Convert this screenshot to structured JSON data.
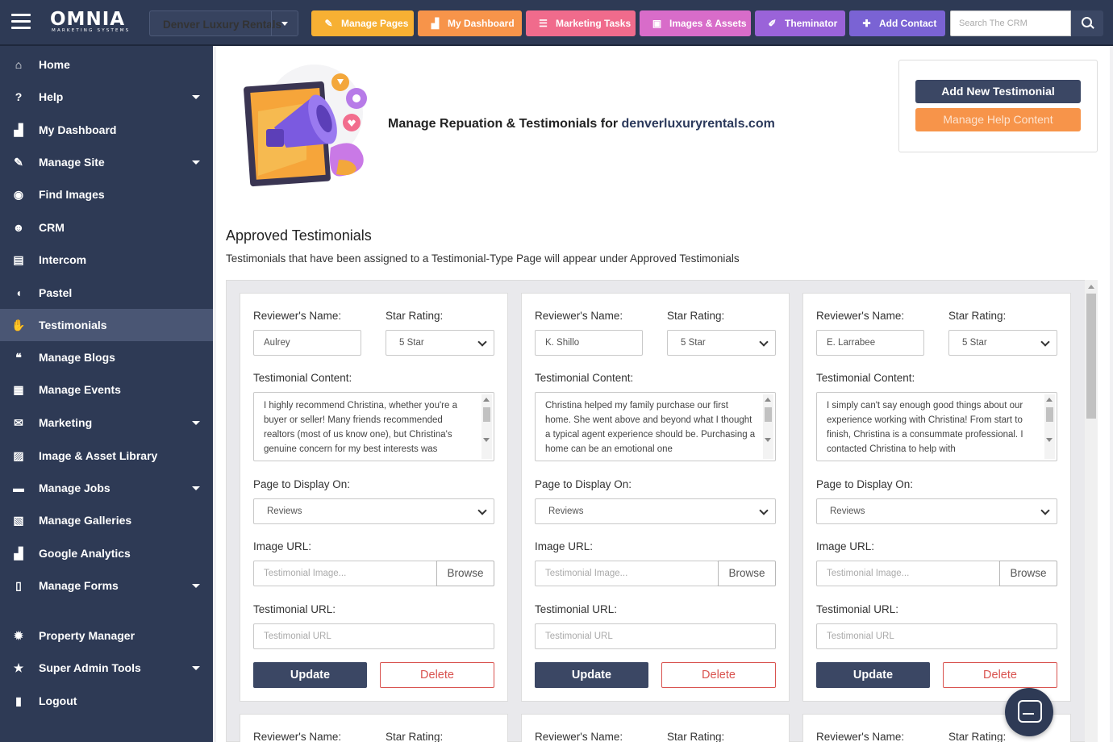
{
  "app": {
    "logo_text": "OMNIA",
    "logo_subtext": "MARKETING SYSTEMS"
  },
  "topbar": {
    "site_selector": "Denver Luxury Rentals",
    "buttons": [
      {
        "label": "Manage Pages",
        "icon": "wrench-icon",
        "color": "#f7b033"
      },
      {
        "label": "My Dashboard",
        "icon": "chart-icon",
        "color": "#f7944a"
      },
      {
        "label": "Marketing Tasks",
        "icon": "list-icon",
        "color": "#f06b8c"
      },
      {
        "label": "Images & Assets",
        "icon": "image-icon",
        "color": "#d86cc9"
      },
      {
        "label": "Theminator",
        "icon": "brush-icon",
        "color": "#9a63d9"
      },
      {
        "label": "Add Contact",
        "icon": "add-user-icon",
        "color": "#7a63d4"
      }
    ],
    "search_placeholder": "Search The CRM"
  },
  "sidebar": {
    "items": [
      {
        "label": "Home",
        "icon": "home-icon",
        "has_caret": false
      },
      {
        "label": "Help",
        "icon": "question-icon",
        "has_caret": true
      },
      {
        "label": "My Dashboard",
        "icon": "chart-icon",
        "has_caret": false
      },
      {
        "label": "Manage Site",
        "icon": "wrench-icon",
        "has_caret": true
      },
      {
        "label": "Find Images",
        "icon": "camera-icon",
        "has_caret": false
      },
      {
        "label": "CRM",
        "icon": "users-icon",
        "has_caret": false
      },
      {
        "label": "Intercom",
        "icon": "intercom-icon",
        "has_caret": false
      },
      {
        "label": "Pastel",
        "icon": "pastel-icon",
        "has_caret": false
      },
      {
        "label": "Testimonials",
        "icon": "handshake-icon",
        "has_caret": false,
        "active": true
      },
      {
        "label": "Manage Blogs",
        "icon": "comments-icon",
        "has_caret": false
      },
      {
        "label": "Manage Events",
        "icon": "calendar-icon",
        "has_caret": false
      },
      {
        "label": "Marketing",
        "icon": "envelope-icon",
        "has_caret": true
      },
      {
        "label": "Image & Asset Library",
        "icon": "picture-icon",
        "has_caret": false
      },
      {
        "label": "Manage Jobs",
        "icon": "briefcase-icon",
        "has_caret": true
      },
      {
        "label": "Manage Galleries",
        "icon": "gallery-icon",
        "has_caret": false
      },
      {
        "label": "Google Analytics",
        "icon": "chart-icon",
        "has_caret": false
      },
      {
        "label": "Manage Forms",
        "icon": "file-icon",
        "has_caret": true
      },
      {
        "label": "Property Manager",
        "icon": "gear-icon",
        "has_caret": false
      },
      {
        "label": "Super Admin Tools",
        "icon": "star-icon",
        "has_caret": true
      },
      {
        "label": "Logout",
        "icon": "lock-icon",
        "has_caret": false
      }
    ]
  },
  "header": {
    "title_prefix": "Manage Repuation & Testimonials for",
    "domain": "denverluxuryrentals.com"
  },
  "actions": {
    "add_label": "Add New Testimonial",
    "help_label": "Manage Help Content"
  },
  "section": {
    "title": "Approved Testimonials",
    "description": "Testimonials that have been assigned to a Testimonial-Type Page will appear under Approved Testimonials"
  },
  "labels": {
    "name": "Reviewer's Name:",
    "rating": "Star Rating:",
    "content": "Testimonial Content:",
    "page": "Page to Display On:",
    "image": "Image URL:",
    "url": "Testimonial URL:",
    "image_placeholder": "Testimonial Image...",
    "url_placeholder": "Testimonial URL",
    "browse": "Browse",
    "update": "Update",
    "delete": "Delete"
  },
  "testimonials": [
    {
      "name": "Aulrey",
      "rating": "5 Star",
      "content": "I highly recommend Christina, whether you're a buyer or seller! Many friends recommended realtors (most of us know one), but Christina's genuine concern for my best interests was",
      "page": "Reviews"
    },
    {
      "name": "K. Shillo",
      "rating": "5 Star",
      "content": "Christina helped my family purchase our first home. She went above and beyond what I thought a typical agent experience should be. Purchasing a home can be an emotional one",
      "page": "Reviews"
    },
    {
      "name": "E. Larrabee",
      "rating": "5 Star",
      "content": "I simply can't say enough good things about our experience working with Christina! From start to finish, Christina is a consummate professional. I contacted Christina to help with",
      "page": "Reviews"
    }
  ]
}
